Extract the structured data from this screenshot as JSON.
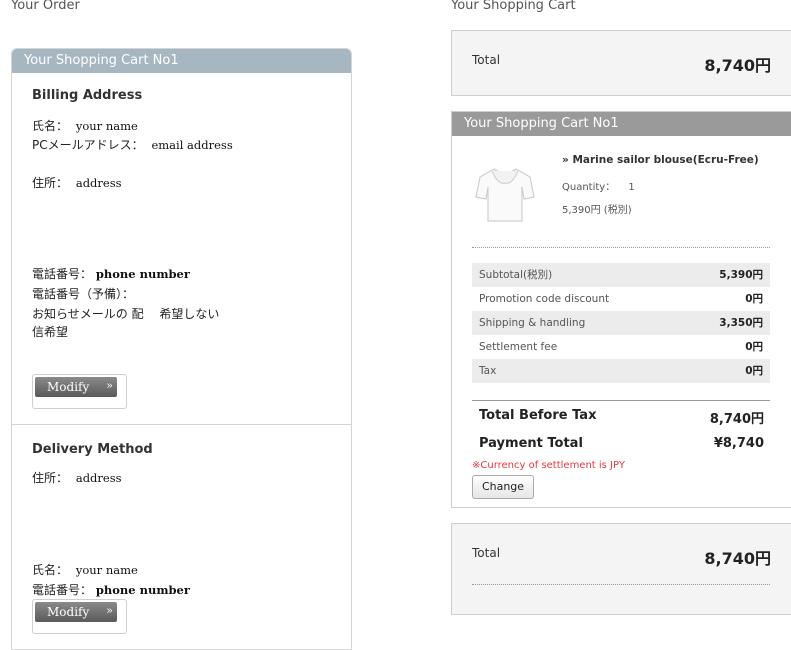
{
  "left_heading": "Your Order",
  "right_heading": "Your Shopping Cart",
  "left_panel": {
    "title": "Your Shopping Cart No1",
    "billing": {
      "title": "Billing Address",
      "name_label": "氏名：",
      "name_value": "your name",
      "email_label": "PCメールアドレス：",
      "email_value": "email address",
      "address_label": "住所：",
      "address_value": "address",
      "phone_label": "電話番号：",
      "phone_value": "phone number",
      "phone2_label": "電話番号（予備）：",
      "newsletter_line1": "お知らせメールの 配",
      "newsletter_value": "希望しない",
      "newsletter_line2": "信希望",
      "modify_label": "Modify",
      "modify_arrow": "»"
    },
    "delivery": {
      "title": "Delivery Method",
      "address_label": "住所：",
      "address_value": "address",
      "name_label": "氏名：",
      "name_value": "your name",
      "phone_label": "電話番号：",
      "phone_value": "phone number",
      "modify_label": "Modify",
      "modify_arrow": "»"
    }
  },
  "top_total": {
    "label": "Total",
    "value": "8,740円"
  },
  "cart": {
    "title": "Your Shopping Cart No1",
    "product": {
      "name_prefix": "»",
      "name": "Marine sailor blouse(Ecru-Free)",
      "quantity_label": "Quantity：",
      "quantity_value": "1",
      "price": "5,390円 (税別)"
    },
    "costs": [
      {
        "label": "Subtotal(税別)",
        "value": "5,390円"
      },
      {
        "label": "Promotion code discount",
        "value": "0円"
      },
      {
        "label": "Shipping & handling",
        "value": "3,350円"
      },
      {
        "label": "Settlement fee",
        "value": "0円"
      },
      {
        "label": "Tax",
        "value": "0円"
      }
    ],
    "before_tax_label": "Total Before Tax",
    "before_tax_value": "8,740円",
    "payment_total_label": "Payment Total",
    "payment_total_value": "¥8,740",
    "currency_note": "※Currency of settlement is JPY",
    "change_label": "Change"
  },
  "bottom_total": {
    "label": "Total",
    "value": "8,740円"
  },
  "colors": {
    "left_header": "#a7b7c2",
    "cart_header": "#9a9a9a",
    "note_red": "#e8383d"
  }
}
